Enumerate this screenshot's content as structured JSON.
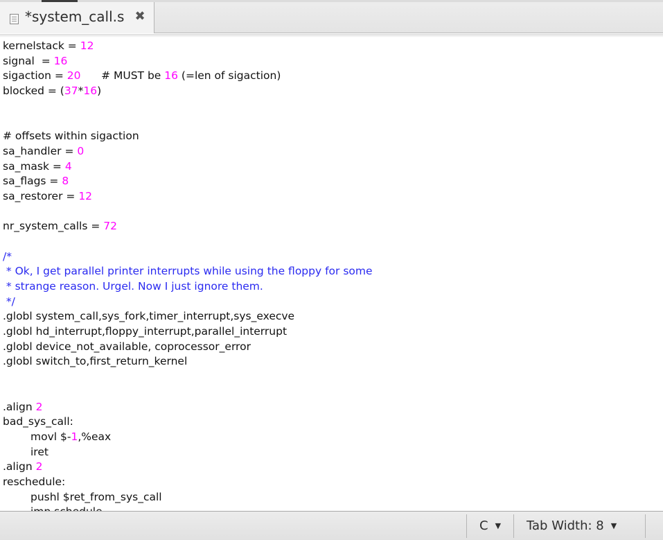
{
  "tab": {
    "title": "*system_call.s",
    "close_glyph": "✖"
  },
  "editor": {
    "colors": {
      "number": "#ff00ff",
      "comment": "#2a2af0",
      "text": "#111111"
    },
    "lines": [
      {
        "indent": false,
        "segs": [
          [
            "kernelstack = ",
            "t"
          ],
          [
            "12",
            "n"
          ]
        ]
      },
      {
        "indent": false,
        "segs": [
          [
            "signal  = ",
            "t"
          ],
          [
            "16",
            "n"
          ]
        ]
      },
      {
        "indent": false,
        "segs": [
          [
            "sigaction = ",
            "t"
          ],
          [
            "20",
            "n"
          ],
          [
            "      # MUST be ",
            "t"
          ],
          [
            "16",
            "n"
          ],
          [
            " (=len of sigaction)",
            "t"
          ]
        ]
      },
      {
        "indent": false,
        "segs": [
          [
            "blocked = (",
            "t"
          ],
          [
            "37",
            "n"
          ],
          [
            "*",
            "t"
          ],
          [
            "16",
            "n"
          ],
          [
            ")",
            "t"
          ]
        ]
      },
      {
        "indent": false,
        "segs": []
      },
      {
        "indent": false,
        "segs": []
      },
      {
        "indent": false,
        "segs": [
          [
            "# offsets within sigaction",
            "t"
          ]
        ]
      },
      {
        "indent": false,
        "segs": [
          [
            "sa_handler = ",
            "t"
          ],
          [
            "0",
            "n"
          ]
        ]
      },
      {
        "indent": false,
        "segs": [
          [
            "sa_mask = ",
            "t"
          ],
          [
            "4",
            "n"
          ]
        ]
      },
      {
        "indent": false,
        "segs": [
          [
            "sa_flags = ",
            "t"
          ],
          [
            "8",
            "n"
          ]
        ]
      },
      {
        "indent": false,
        "segs": [
          [
            "sa_restorer = ",
            "t"
          ],
          [
            "12",
            "n"
          ]
        ]
      },
      {
        "indent": false,
        "segs": []
      },
      {
        "indent": false,
        "segs": [
          [
            "nr_system_calls = ",
            "t"
          ],
          [
            "72",
            "n"
          ]
        ]
      },
      {
        "indent": false,
        "segs": []
      },
      {
        "indent": false,
        "segs": [
          [
            "/*",
            "c"
          ]
        ]
      },
      {
        "indent": false,
        "segs": [
          [
            " * Ok, I get parallel printer interrupts while using the floppy for some",
            "c"
          ]
        ]
      },
      {
        "indent": false,
        "segs": [
          [
            " * strange reason. Urgel. Now I just ignore them.",
            "c"
          ]
        ]
      },
      {
        "indent": false,
        "segs": [
          [
            " */",
            "c"
          ]
        ]
      },
      {
        "indent": false,
        "segs": [
          [
            ".globl system_call,sys_fork,timer_interrupt,sys_execve",
            "t"
          ]
        ]
      },
      {
        "indent": false,
        "segs": [
          [
            ".globl hd_interrupt,floppy_interrupt,parallel_interrupt",
            "t"
          ]
        ]
      },
      {
        "indent": false,
        "segs": [
          [
            ".globl device_not_available, coprocessor_error",
            "t"
          ]
        ]
      },
      {
        "indent": false,
        "segs": [
          [
            ".globl switch_to,first_return_kernel",
            "t"
          ]
        ]
      },
      {
        "indent": false,
        "segs": []
      },
      {
        "indent": false,
        "segs": []
      },
      {
        "indent": false,
        "segs": [
          [
            ".align ",
            "t"
          ],
          [
            "2",
            "n"
          ]
        ]
      },
      {
        "indent": false,
        "segs": [
          [
            "bad_sys_call:",
            "t"
          ]
        ]
      },
      {
        "indent": true,
        "segs": [
          [
            "movl $-",
            "t"
          ],
          [
            "1",
            "n"
          ],
          [
            ",%eax",
            "t"
          ]
        ]
      },
      {
        "indent": true,
        "segs": [
          [
            "iret",
            "t"
          ]
        ]
      },
      {
        "indent": false,
        "segs": [
          [
            ".align ",
            "t"
          ],
          [
            "2",
            "n"
          ]
        ]
      },
      {
        "indent": false,
        "segs": [
          [
            "reschedule:",
            "t"
          ]
        ]
      },
      {
        "indent": true,
        "segs": [
          [
            "pushl $ret_from_sys_call",
            "t"
          ]
        ]
      },
      {
        "indent": true,
        "segs": [
          [
            "jmp schedule",
            "t"
          ]
        ]
      }
    ]
  },
  "statusbar": {
    "language": "C",
    "tab_width_label": "Tab Width:",
    "tab_width_value": "8",
    "dropdown_glyph": "▼"
  }
}
